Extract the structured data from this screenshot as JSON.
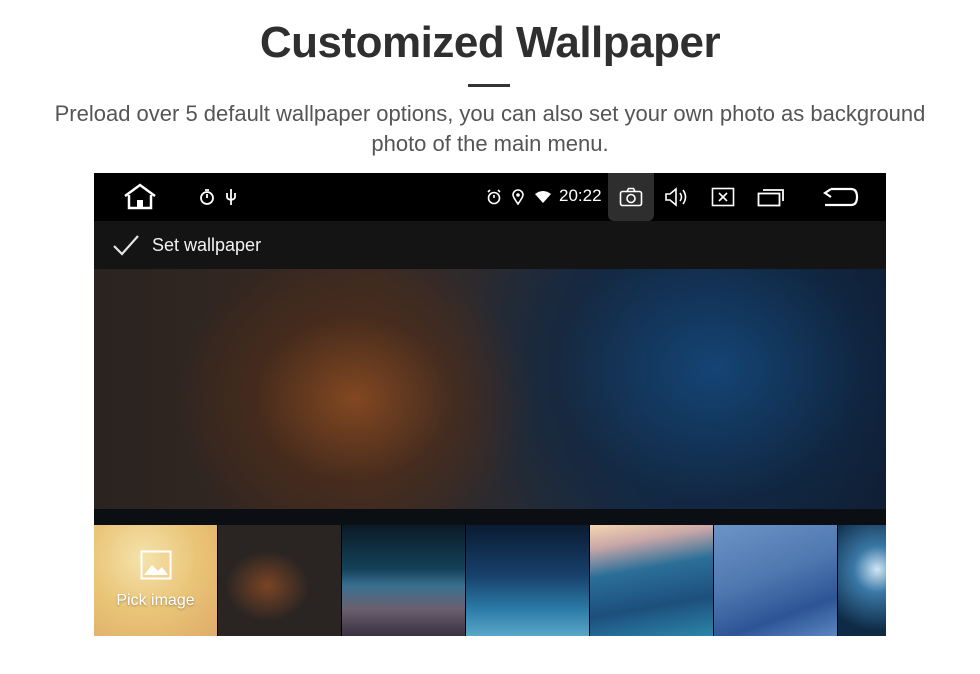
{
  "heading": {
    "title": "Customized Wallpaper",
    "subtitle": "Preload over 5 default wallpaper options, you can also set your own photo as background photo of the main menu."
  },
  "statusbar": {
    "time": "20:22",
    "icons": [
      "home-icon",
      "timer-icon",
      "usb-icon",
      "alarm-icon",
      "location-icon",
      "wifi-icon",
      "camera-icon",
      "volume-icon",
      "close-app-icon",
      "recent-apps-icon",
      "back-icon"
    ]
  },
  "actionbar": {
    "label": "Set wallpaper",
    "icon": "check-icon"
  },
  "thumbnails": {
    "pick_label": "Pick image",
    "pick_icon": "image-icon",
    "count": 7
  },
  "colors": {
    "status_bg": "#000000",
    "action_bg": "#141414",
    "accent_camera": "#2e2e2e"
  }
}
